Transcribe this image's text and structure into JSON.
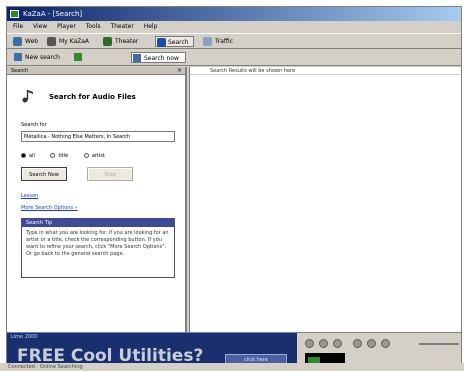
{
  "window": {
    "title": "KaZaA - [Search]"
  },
  "menu": [
    "File",
    "View",
    "Player",
    "Tools",
    "Theater",
    "Help"
  ],
  "toolbar": {
    "items": [
      "Web",
      "My KaZaA",
      "Theater",
      "Search",
      "Traffic"
    ]
  },
  "subtoolbar": {
    "items": [
      "New search",
      "",
      "Search now"
    ]
  },
  "left_pane": {
    "header": "Search",
    "close_symbol": "×",
    "title": "Search for Audio Files",
    "search_for_label": "Search for",
    "search_value": "Metallica - Nothing Else Matters, In Search",
    "radios": [
      {
        "label": "all",
        "selected": true
      },
      {
        "label": "title",
        "selected": false
      },
      {
        "label": "artist",
        "selected": false
      }
    ],
    "search_button": "Search Now",
    "stop_button": "Stop",
    "link_1": "Lesson",
    "link_2": "More Search Options »",
    "tip_title": "Search Tip",
    "tip_text": "Type in what you are looking for. If you are looking for an artist or a title, check the corresponding button. If you want to refine your search, click \"More Search Options\". Or go back to the general search page."
  },
  "right_pane": {
    "header": "Search Results will be shown here"
  },
  "banner": {
    "tag": "Lime 2000",
    "headline": "FREE Cool Utilities?",
    "button": "click here"
  },
  "player": {
    "slider_level": 0.3
  },
  "statusbar": {
    "text": "Connected - Online Searching"
  },
  "colors": {
    "title_bar": "#0a246a",
    "banner_bg": "#1a2f6e",
    "link": "#1a3cc8"
  }
}
